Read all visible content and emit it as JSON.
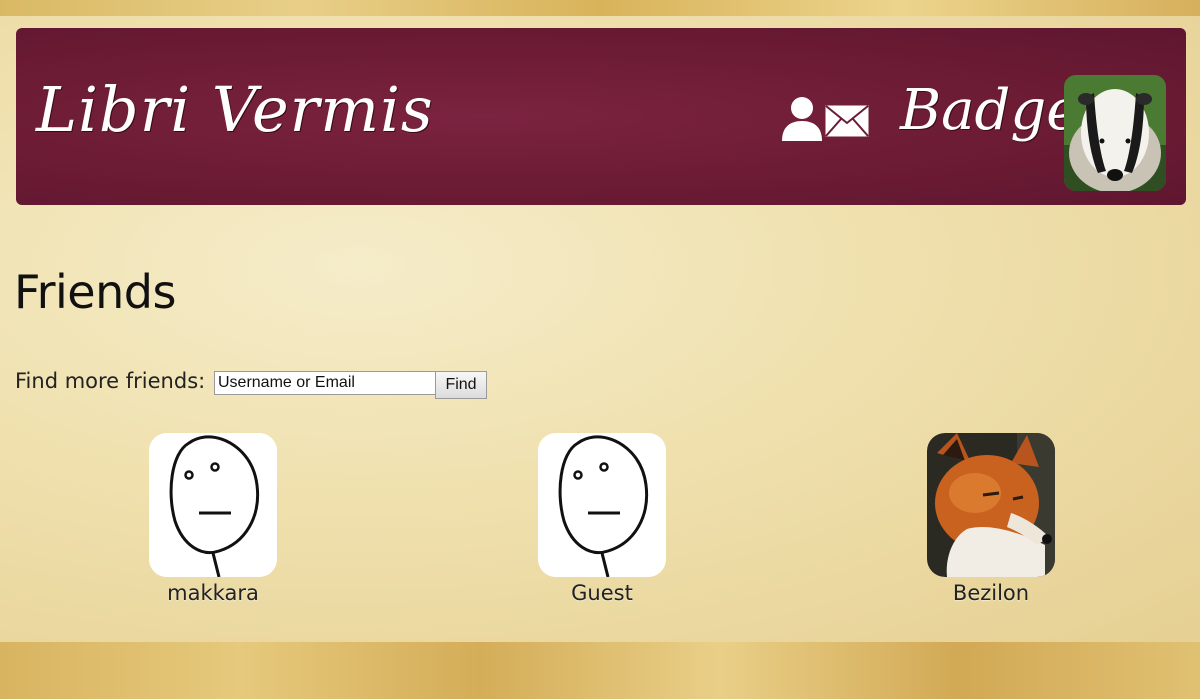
{
  "header": {
    "site_title": "Libri Vermis",
    "username": "Badger",
    "icons": {
      "profile": "profile-icon",
      "messages": "mail-icon"
    }
  },
  "page": {
    "title": "Friends"
  },
  "find_friends": {
    "label": "Find more friends:",
    "placeholder": "Username or Email",
    "button_label": "Find"
  },
  "friends": [
    {
      "name": "makkara",
      "avatar": "poker-face-avatar"
    },
    {
      "name": "Guest",
      "avatar": "poker-face-avatar"
    },
    {
      "name": "Bezilon",
      "avatar": "fox-avatar"
    }
  ],
  "colors": {
    "header_bg": "#6b1b33",
    "page_bg": "#efe0ad"
  }
}
